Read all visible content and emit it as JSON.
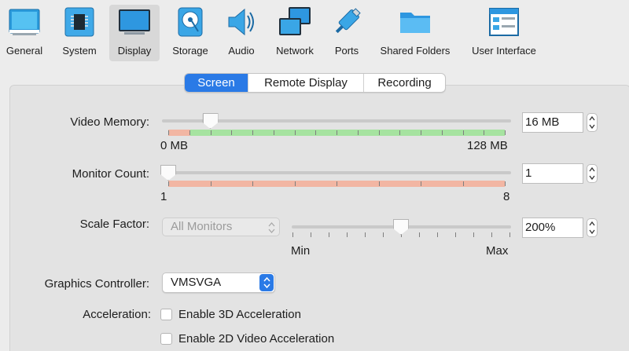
{
  "toolbar": {
    "items": [
      {
        "label": "General",
        "icon": "general-icon"
      },
      {
        "label": "System",
        "icon": "chip-icon"
      },
      {
        "label": "Display",
        "icon": "monitor-icon",
        "selected": true
      },
      {
        "label": "Storage",
        "icon": "hard-disk-icon"
      },
      {
        "label": "Audio",
        "icon": "speaker-icon"
      },
      {
        "label": "Network",
        "icon": "network-icon"
      },
      {
        "label": "Ports",
        "icon": "usb-plug-icon"
      },
      {
        "label": "Shared Folders",
        "icon": "folder-icon"
      },
      {
        "label": "User Interface",
        "icon": "window-icon"
      }
    ]
  },
  "tabs": [
    {
      "label": "Screen",
      "active": true
    },
    {
      "label": "Remote Display",
      "active": false
    },
    {
      "label": "Recording",
      "active": false
    }
  ],
  "video_memory": {
    "label": "Video Memory:",
    "value": "16 MB",
    "min_label": "0 MB",
    "max_label": "128 MB",
    "fraction": 0.125
  },
  "monitor_count": {
    "label": "Monitor Count:",
    "value": "1",
    "min_label": "1",
    "max_label": "8",
    "fraction": 0
  },
  "scale_factor": {
    "label": "Scale Factor:",
    "monitor_select": "All Monitors",
    "value": "200%",
    "min_label": "Min",
    "max_label": "Max",
    "fraction": 0.5
  },
  "graphics_controller": {
    "label": "Graphics Controller:",
    "value": "VMSVGA"
  },
  "acceleration": {
    "label": "Acceleration:",
    "options": [
      {
        "label": "Enable 3D Acceleration",
        "checked": false
      },
      {
        "label": "Enable 2D Video Acceleration",
        "checked": false
      }
    ]
  },
  "colors": {
    "accent": "#2a7ae6",
    "scale_green": "#a6e3a0",
    "scale_red": "#f2b6a3"
  }
}
